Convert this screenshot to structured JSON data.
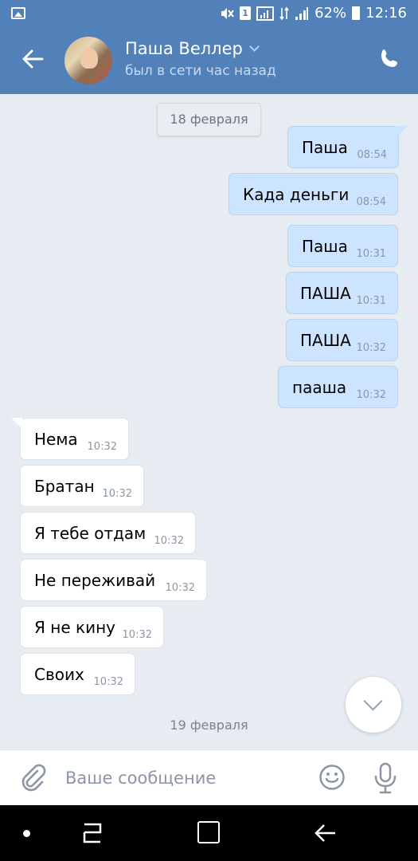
{
  "status_bar": {
    "sim": "1",
    "battery": "62%",
    "time": "12:16"
  },
  "header": {
    "name": "Паша Веллер",
    "last_seen": "был в сети час назад"
  },
  "chat": {
    "date_1": "18 февраля",
    "date_2": "19 февраля",
    "messages": [
      {
        "dir": "out",
        "text": "Паша",
        "time": "08:54"
      },
      {
        "dir": "out",
        "text": "Када деньги",
        "time": "08:54"
      },
      {
        "dir": "out",
        "text": "Паша",
        "time": "10:31"
      },
      {
        "dir": "out",
        "text": "ПАША",
        "time": "10:31"
      },
      {
        "dir": "out",
        "text": "ПАША",
        "time": "10:32"
      },
      {
        "dir": "out",
        "text": "пааша",
        "time": "10:32"
      },
      {
        "dir": "in",
        "text": "Нема",
        "time": "10:32"
      },
      {
        "dir": "in",
        "text": "Братан",
        "time": "10:32"
      },
      {
        "dir": "in",
        "text": "Я тебе отдам",
        "time": "10:32"
      },
      {
        "dir": "in",
        "text": "Не переживай",
        "time": "10:32"
      },
      {
        "dir": "in",
        "text": "Я не кину",
        "time": "10:32"
      },
      {
        "dir": "in",
        "text": "Своих",
        "time": "10:32"
      }
    ]
  },
  "composer": {
    "placeholder": "Ваше сообщение"
  },
  "icons": {
    "back": "arrow-left-icon",
    "call": "phone-icon",
    "attach": "paperclip-icon",
    "emoji": "smiley-icon",
    "mic": "microphone-icon",
    "scroll": "chevron-down-icon"
  },
  "colors": {
    "header_bg": "#5181b8",
    "outgoing_bubble": "#cce4ff",
    "incoming_bubble": "#ffffff",
    "chat_bg": "#e7ecf2"
  }
}
